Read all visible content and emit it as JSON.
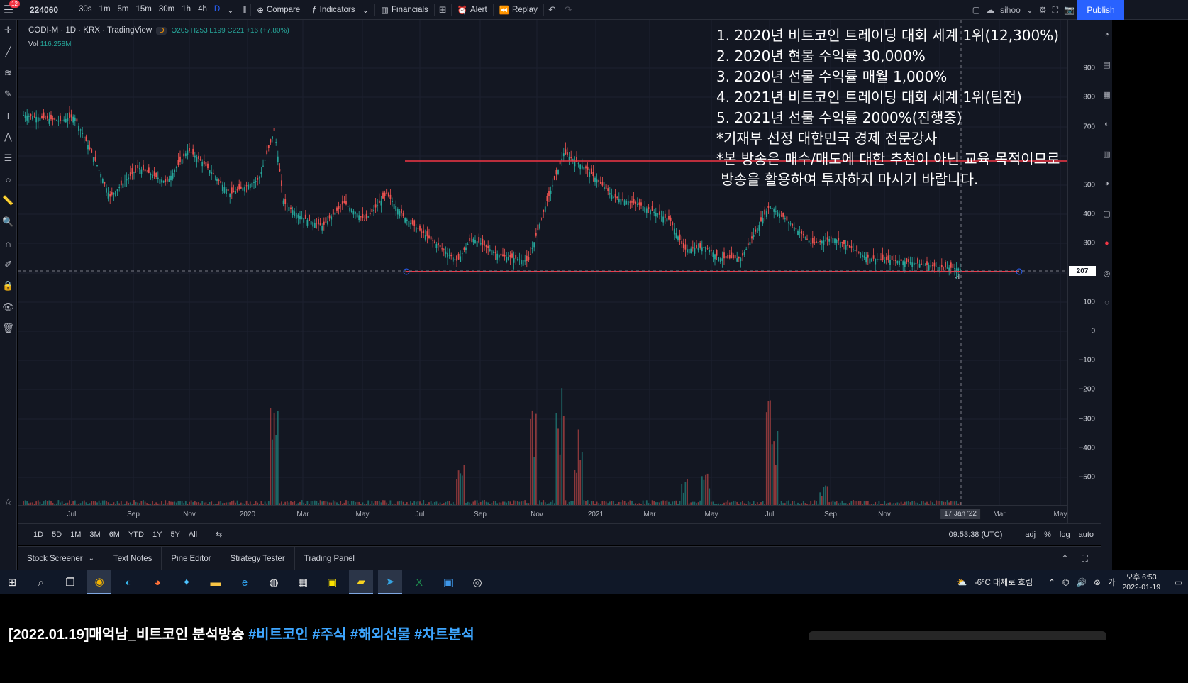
{
  "topbar": {
    "badge": "12",
    "symbol": "224060",
    "intervals": [
      "30s",
      "1m",
      "5m",
      "15m",
      "30m",
      "1h",
      "4h",
      "D"
    ],
    "compare": "Compare",
    "indicators": "Indicators",
    "financials": "Financials",
    "alert": "Alert",
    "replay": "Replay",
    "user": "sihoo",
    "publish": "Publish"
  },
  "legend": {
    "title": "CODI-M · 1D · KRX · TradingView",
    "tag": "D",
    "ohlc": "O205 H253 L199 C221 +16 (+7.80%)",
    "vol_label": "Vol",
    "vol_value": "116.258M"
  },
  "price_axis": {
    "labels": [
      "900",
      "800",
      "700",
      "500",
      "400",
      "300",
      "100",
      "0",
      "−100",
      "−200",
      "−300",
      "−400",
      "−500"
    ],
    "current": "207"
  },
  "time_axis": {
    "labels": [
      "Jul",
      "Sep",
      "Nov",
      "2020",
      "Mar",
      "May",
      "Jul",
      "Sep",
      "Nov",
      "2021",
      "Mar",
      "May",
      "Jul",
      "Sep",
      "Nov",
      "Mar",
      "May"
    ],
    "cursor_date": "17 Jan '22"
  },
  "range_bar": {
    "ranges": [
      "1D",
      "5D",
      "1M",
      "3M",
      "6M",
      "YTD",
      "1Y",
      "5Y",
      "All"
    ],
    "time": "09:53:38 (UTC)",
    "adj": "adj",
    "percent": "%",
    "log": "log",
    "auto": "auto"
  },
  "bottom_tabs": [
    "Stock Screener",
    "Text Notes",
    "Pine Editor",
    "Strategy Tester",
    "Trading Panel"
  ],
  "overlay": [
    "1. 2020년 비트코인 트레이딩 대회 세계 1위(12,300%)",
    "2. 2020년 현물 수익률 30,000%",
    "3. 2020년 선물 수익률 매월 1,000%",
    "4. 2021년 비트코인 트레이딩 대회 세계 1위(팀전)",
    "5. 2021년 선물 수익률 2000%(진행중)",
    "*기재부 선정 대한민국 경제 전문강사",
    "*본 방송은 매수/매도에 대한 추천이 아닌 교육 목적이므로",
    " 방송을 활용하여 투자하지 마시기 바랍니다."
  ],
  "taskbar": {
    "weather": "-6°C 대체로 흐림",
    "clock_time": "오후 6:53",
    "clock_date": "2022-01-19"
  },
  "caption": {
    "title": "[2022.01.19]매억남_비트코인 분석방송",
    "tags": "#비트코인 #주식 #해외선물 #차트분석"
  },
  "colors": {
    "up": "#26a69a",
    "down": "#ef5350",
    "hline": "#f23645",
    "accent": "#2962ff"
  }
}
